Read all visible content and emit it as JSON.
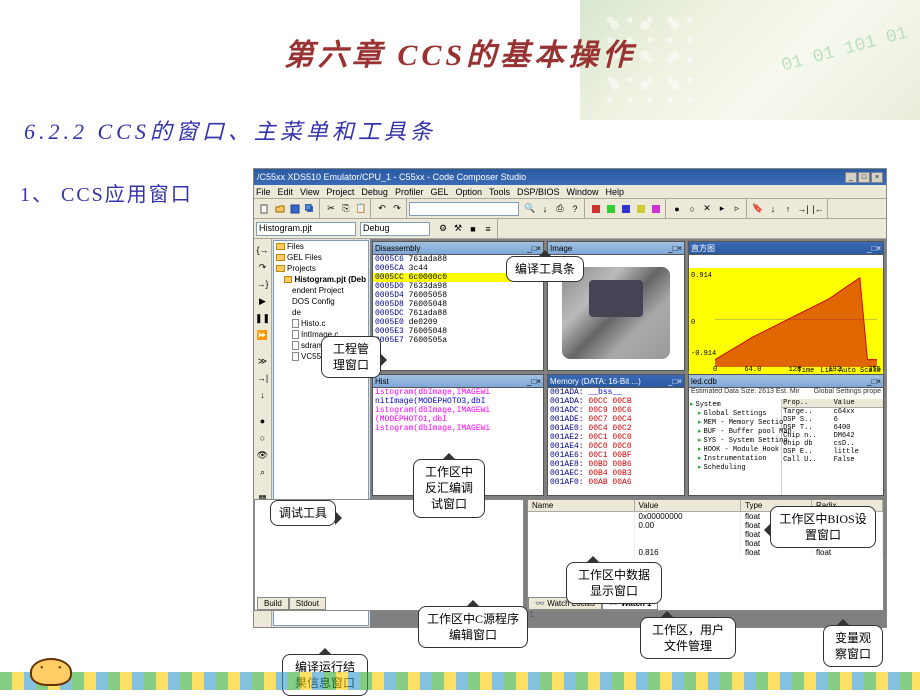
{
  "page": {
    "title": "第六章 CCS的基本操作",
    "subtitle": "6.2.2 CCS的窗口、主菜单和工具条",
    "label1": "1、 CCS应用窗口"
  },
  "app": {
    "window_title": "/C55xx XDS510 Emulator/CPU_1 - C55xx - Code Composer Studio",
    "menus": [
      "File",
      "Edit",
      "View",
      "Project",
      "Debug",
      "Profiler",
      "GEL",
      "Option",
      "Tools",
      "DSP/BIOS",
      "Window",
      "Help"
    ],
    "project_combo": "Histogram.pjt",
    "config_combo": "Debug"
  },
  "project_tree": {
    "items": [
      "Files",
      "GEL Files",
      "Projects",
      "Histogram.pjt (Deb",
      "endent Project",
      "DOS Config",
      "de",
      "Histo.c",
      "IntImage.c",
      "sdram_init.c",
      "VC5509.CMD"
    ]
  },
  "disassembly": {
    "title": "Disassembly",
    "lines": [
      {
        "a": "0005C6",
        "o": "761ada88"
      },
      {
        "a": "0005CA",
        "o": "3c44"
      },
      {
        "a": "0005CC",
        "o": "6c0000c0"
      },
      {
        "a": "0005D0",
        "o": "7633da98"
      },
      {
        "a": "0005D4",
        "o": "76005058"
      },
      {
        "a": "0005D8",
        "o": "76005048"
      },
      {
        "a": "0005DC",
        "o": "761ada88"
      },
      {
        "a": "0005E0",
        "o": "de0209"
      },
      {
        "a": "0005E3",
        "o": "76005048"
      },
      {
        "a": "0005E7",
        "o": "7600505a"
      }
    ]
  },
  "image_pane": {
    "title": "Image"
  },
  "graph_pane": {
    "title": "直方图",
    "y_ticks": [
      "0.914",
      "0",
      "-0.914"
    ],
    "x_ticks": [
      "0",
      "64.0",
      "128",
      "192",
      "255"
    ],
    "footer": [
      "Time",
      "Lin",
      "Auto Scale"
    ]
  },
  "source_pane": {
    "title": "Hist",
    "lines": [
      {
        "t": "istogram(dbImage,IMAGEWi",
        "c": "src-line"
      },
      {
        "t": "",
        "c": "src-line"
      },
      {
        "t": "nitImage(MODEPHOTO3,dbI",
        "c": "src-line blue"
      },
      {
        "t": "istogram(dbImage,IMAGEWi",
        "c": "src-line"
      },
      {
        "t": "",
        "c": "src-line"
      },
      {
        "t": "(MODEPHOTO1,dbI",
        "c": "src-line"
      },
      {
        "t": "istogram(dbImage,IMAGEWi",
        "c": "src-line"
      }
    ]
  },
  "memory_pane": {
    "title": "Memory (DATA: 16-Bit ...)",
    "lines": [
      {
        "a": "001ADA:",
        "v": "__bss__",
        "cls": "bss"
      },
      {
        "a": "001ADA:",
        "v": "00CC 00CB"
      },
      {
        "a": "001ADC:",
        "v": "00C9 00C6"
      },
      {
        "a": "001ADE:",
        "v": "00C7 00C4"
      },
      {
        "a": "001AE0:",
        "v": "00C4 00C2"
      },
      {
        "a": "001AE2:",
        "v": "00C1 00C0"
      },
      {
        "a": "001AE4:",
        "v": "00C0 00C0"
      },
      {
        "a": "001AE6:",
        "v": "00C1 00BF"
      },
      {
        "a": "001AE8:",
        "v": "00BD 00B6"
      },
      {
        "a": "001AEC:",
        "v": "00B4 00B3"
      },
      {
        "a": "001AF0:",
        "v": "00AB 00A6"
      }
    ]
  },
  "bios_pane": {
    "title": "led.cdb",
    "status": "Estimated Data Size: 2613  Est. Mir",
    "props_title": "Global Settings prope",
    "tree": [
      "System",
      "Global Settings",
      "MEM - Memory Sectio",
      "BUF - Buffer pool Man",
      "SYS - System Setting",
      "HOOK - Module Hook",
      "Instrumentation",
      "Scheduling"
    ],
    "props_hdr": [
      "Prop..",
      "Value"
    ],
    "props": [
      [
        "Targe..",
        "c64xx"
      ],
      [
        "DSP S..",
        "6"
      ],
      [
        "DSP T..",
        "6400"
      ],
      [
        "Chip n..",
        "DM642"
      ],
      [
        "Chip db",
        "csD.."
      ],
      [
        "DSP E..",
        "little"
      ],
      [
        "Call U..",
        "False"
      ]
    ]
  },
  "watch_pane": {
    "headers": [
      "Name",
      "Value",
      "Type",
      "Radix"
    ],
    "rows": [
      [
        "",
        "0x00000000",
        "float",
        "float"
      ],
      [
        "",
        "0.00",
        "float",
        "float"
      ],
      [
        "",
        "",
        "float",
        "float"
      ],
      [
        "",
        "",
        "float",
        "float"
      ],
      [
        "",
        "0.816",
        "float",
        "float"
      ]
    ],
    "tabs": [
      "Watch Locals",
      "Watch 1"
    ]
  },
  "output_pane": {
    "tabs": [
      "Build",
      "Stdout"
    ],
    "status_text": "ess F1"
  },
  "callouts": {
    "compile": "编译工具条",
    "project": "工程管理窗口",
    "debug": "调试工具",
    "disasm": "工作区中反汇编调试窗口",
    "bios": "工作区中BIOS设置窗口",
    "memory": "工作区中数据显示窗口",
    "source": "工作区中C源程序编辑窗口",
    "filemgr": "工作区，用户文件管理",
    "output": "编译运行结果信息窗口",
    "watch": "变量观察窗口"
  },
  "chart_data": {
    "type": "line",
    "title": "直方图",
    "xlabel": "Time",
    "ylabel": "",
    "xlim": [
      0,
      255
    ],
    "ylim": [
      -0.914,
      0.914
    ],
    "x_ticks": [
      0,
      64,
      128,
      192,
      255
    ],
    "y_ticks": [
      -0.914,
      0,
      0.914
    ],
    "note": "Histogram-style curve rising from ~-0.9 at x≈0 toward peak ~0.9 near x≈230 then dropping; values estimated from plot.",
    "series": [
      {
        "name": "histogram",
        "x": [
          0,
          32,
          64,
          96,
          128,
          160,
          192,
          224,
          240,
          255
        ],
        "y": [
          -0.8,
          -0.6,
          -0.3,
          -0.1,
          0.1,
          0.3,
          0.5,
          0.8,
          0.9,
          -0.9
        ]
      }
    ]
  }
}
